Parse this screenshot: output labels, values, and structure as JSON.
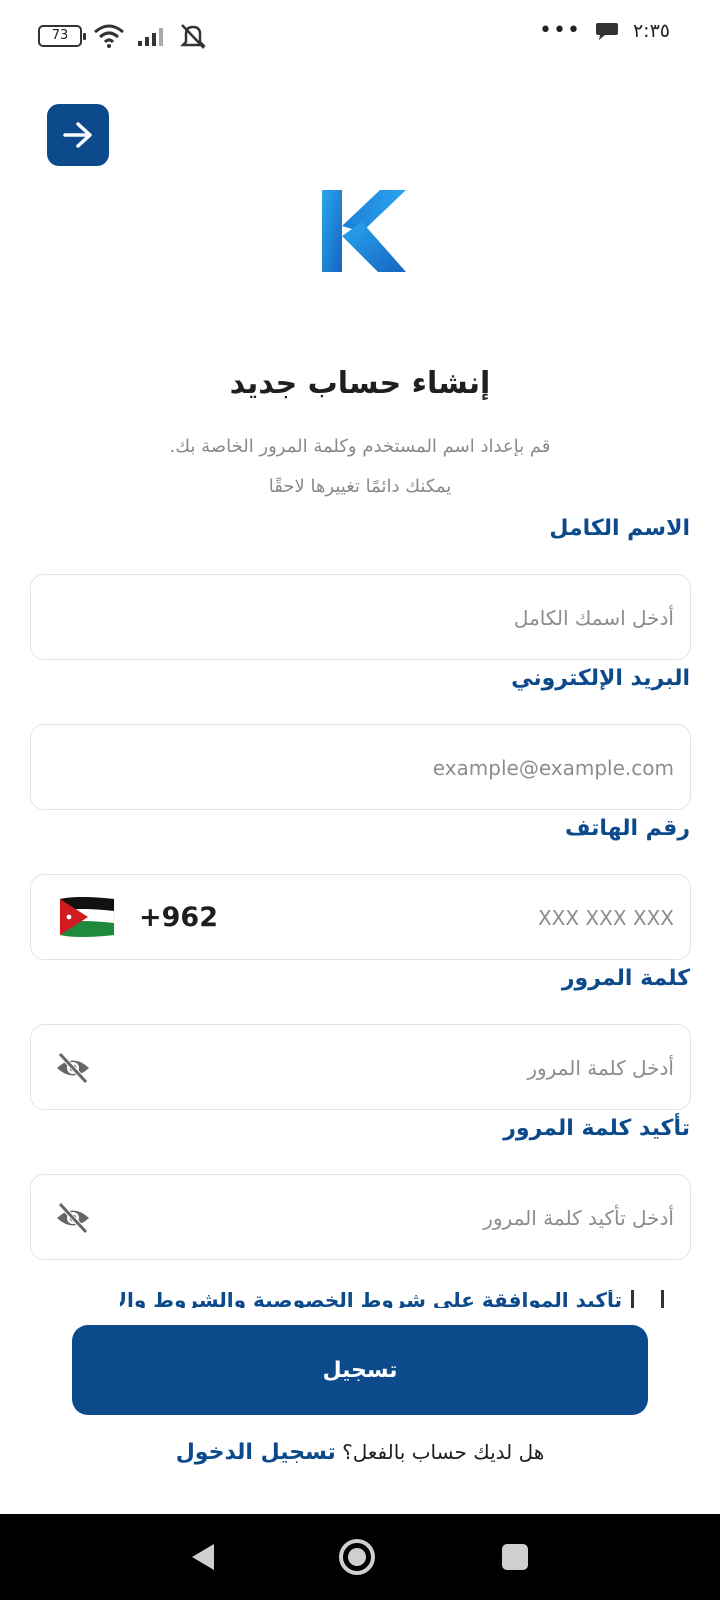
{
  "status_bar": {
    "battery": "73",
    "time": "٢:٣٥",
    "more": "•••"
  },
  "header": {
    "title": "إنشاء حساب جديد",
    "subtitle_line1": "قم بإعداد اسم المستخدم وكلمة المرور الخاصة بك.",
    "subtitle_line2": "يمكنك دائمًا تغييرها لاحقًا"
  },
  "form": {
    "full_name": {
      "label": "الاسم الكامل",
      "placeholder": "أدخل اسمك الكامل"
    },
    "email": {
      "label": "البريد الإلكتروني",
      "placeholder": "example@example.com"
    },
    "phone": {
      "label": "رقم الهاتف",
      "placeholder": "XXX XXX XXX",
      "country_code": "+962"
    },
    "password": {
      "label": "كلمة المرور",
      "placeholder": "أدخل كلمة المرور"
    },
    "confirm_password": {
      "label": "تأكيد كلمة المرور",
      "placeholder": "أدخل تأكيد كلمة المرور"
    },
    "terms_label": "تأكيد الموافقة على شروط الخصوصية والشروط والأحكام"
  },
  "actions": {
    "register": "تسجيل",
    "have_account": "هل لديك حساب بالفعل؟",
    "login": "تسجيل الدخول"
  },
  "colors": {
    "primary": "#0c4a8c",
    "logo_light": "#2aa6ee",
    "logo_dark": "#1565c0"
  },
  "icons": [
    "battery-icon",
    "wifi-icon",
    "signal-icon",
    "mute-icon",
    "message-icon",
    "arrow-right-icon",
    "eye-off-icon",
    "jordan-flag-icon",
    "nav-back-icon",
    "nav-home-icon",
    "nav-recents-icon"
  ]
}
